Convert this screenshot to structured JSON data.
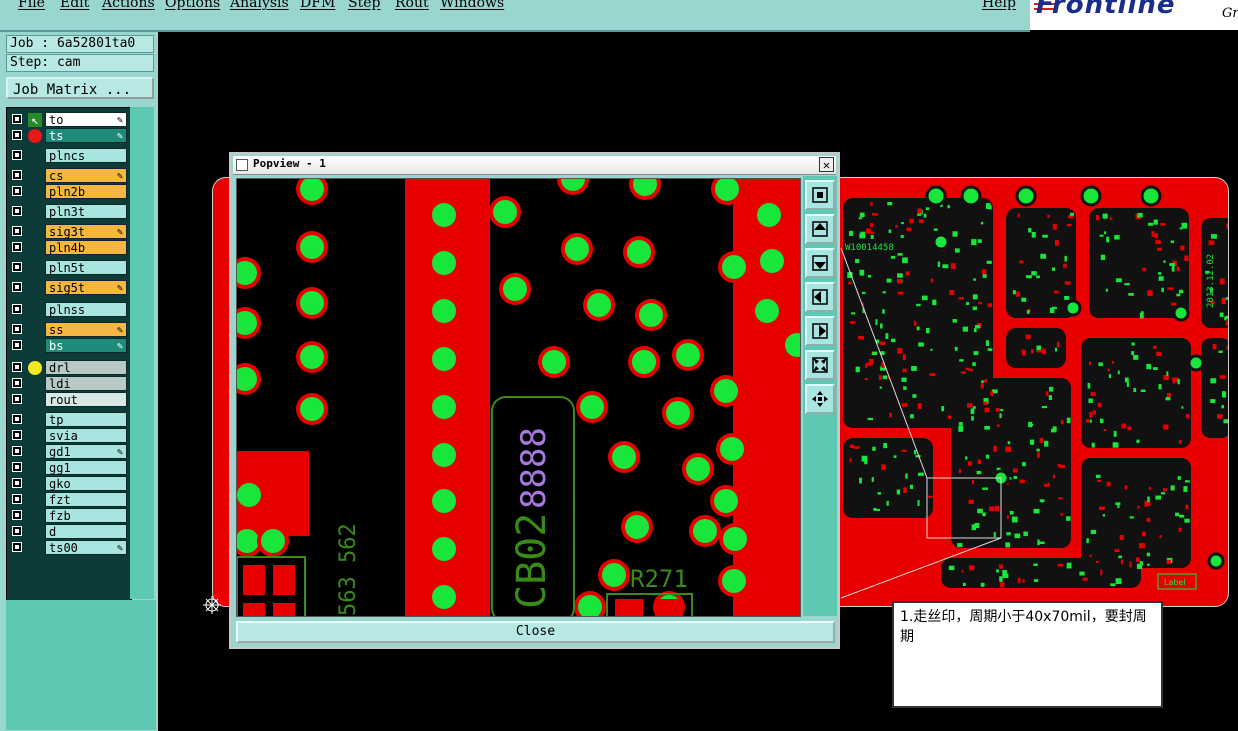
{
  "menubar": {
    "items": [
      "File",
      "Edit",
      "Actions",
      "Options",
      "Analysis",
      "DFM",
      "Step",
      "Rout",
      "Windows"
    ],
    "help": "Help"
  },
  "brand": {
    "logo": "Frontline",
    "tag": "Gr"
  },
  "job": {
    "job_line": "Job : 6a52801ta0",
    "step_line": "Step: cam",
    "matrix_button": "Job Matrix ..."
  },
  "layers": [
    {
      "name": "to",
      "style": "white",
      "icon": "green-arrow",
      "pen": true
    },
    {
      "name": "ts",
      "style": "green",
      "icon": "red-dot",
      "pen": true
    },
    {
      "name": "plncs",
      "style": "cyan"
    },
    {
      "name": "cs",
      "style": "orange",
      "pen": true
    },
    {
      "name": "pln2b",
      "style": "orange"
    },
    {
      "name": "pln3t",
      "style": "cyan"
    },
    {
      "name": "sig3t",
      "style": "orange",
      "pen": true
    },
    {
      "name": "pln4b",
      "style": "orange"
    },
    {
      "name": "pln5t",
      "style": "cyan"
    },
    {
      "name": "sig5t",
      "style": "orange",
      "pen": true
    },
    {
      "name": "plnss",
      "style": "cyan"
    },
    {
      "name": "ss",
      "style": "orange",
      "pen": true
    },
    {
      "name": "bs",
      "style": "green",
      "pen": true
    },
    {
      "name": "drl",
      "style": "gray",
      "icon": "yellow-dot"
    },
    {
      "name": "ldi",
      "style": "gray"
    },
    {
      "name": "rout",
      "style": "light"
    },
    {
      "name": "tp",
      "style": "cyan"
    },
    {
      "name": "svia",
      "style": "cyan"
    },
    {
      "name": "gd1",
      "style": "cyan",
      "pen": true
    },
    {
      "name": "gg1",
      "style": "cyan"
    },
    {
      "name": "gko",
      "style": "cyan"
    },
    {
      "name": "fzt",
      "style": "cyan"
    },
    {
      "name": "fzb",
      "style": "cyan"
    },
    {
      "name": "d",
      "style": "cyan"
    },
    {
      "name": "ts00",
      "style": "cyan",
      "pen": true
    }
  ],
  "popview": {
    "title": "Popview - 1",
    "close_button": "Close",
    "silkscreen_text": "CB02",
    "silkscreen_text2": "R271",
    "silkscreen_text3": "563 562",
    "silkscreen_date": "8888",
    "tools": [
      "zoom-fit-icon",
      "move-up-icon",
      "move-down-icon",
      "move-left-icon",
      "move-right-icon",
      "zoom-out-icon",
      "pan-icon"
    ]
  },
  "board_text": {
    "label": "Label",
    "code": "W10014458",
    "date": "2013.12.02"
  },
  "note": {
    "text": "1.走丝印，周期小于40x70mil，要封周期"
  },
  "colors": {
    "panel": "#9ad6d0",
    "copper": "#e80000",
    "pad": "#19e63a",
    "silk_purple": "#a77ae0"
  }
}
